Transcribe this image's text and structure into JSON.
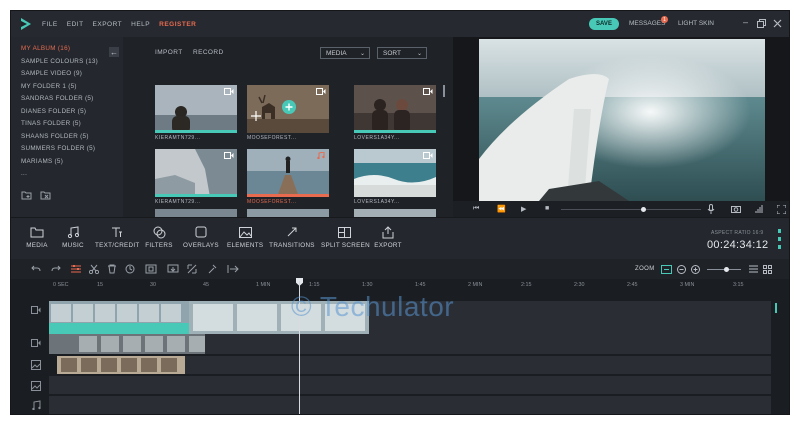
{
  "menu": {
    "items": [
      "FILE",
      "EDIT",
      "EXPORT",
      "HELP",
      "REGISTER"
    ]
  },
  "header": {
    "save_label": "SAVE",
    "messages_label": "MESSAGES",
    "messages_badge": "1",
    "skin_label": "LIGHT SKIN"
  },
  "folders": [
    "MY ALBUM (16)",
    "SAMPLE COLOURS (13)",
    "SAMPLE VIDEO (9)",
    "MY FOLDER 1 (5)",
    "SANDRAS FOLDER (5)",
    "DIANES FOLDER (5)",
    "TINAS FOLDER (5)",
    "SHAANS FOLDER (5)",
    "SUMMERS FOLDER (5)",
    "MARIAMS (5)",
    "..."
  ],
  "library": {
    "import_label": "IMPORT",
    "record_label": "RECORD",
    "media_select": "MEDIA",
    "sort_select": "SORT",
    "thumbs": [
      {
        "label": "KIERAMTN729...",
        "type": "video"
      },
      {
        "label": "MOOSEFOREST...",
        "type": "video"
      },
      {
        "label": "LOVERS1A34Y...",
        "type": "video"
      },
      {
        "label": "KIERAMTN729...",
        "type": "video"
      },
      {
        "label": "MOOSEFOREST...",
        "type": "audio"
      },
      {
        "label": "LOVERS1A34Y...",
        "type": "video"
      }
    ]
  },
  "tools": [
    {
      "label": "MEDIA",
      "icon": "folder-icon"
    },
    {
      "label": "MUSIC",
      "icon": "music-icon"
    },
    {
      "label": "TEXT/CREDIT",
      "icon": "text-icon"
    },
    {
      "label": "FILTERS",
      "icon": "filters-icon"
    },
    {
      "label": "OVERLAYS",
      "icon": "overlays-icon"
    },
    {
      "label": "ELEMENTS",
      "icon": "elements-icon"
    },
    {
      "label": "TRANSITIONS",
      "icon": "transitions-icon"
    },
    {
      "label": "SPLIT SCREEN",
      "icon": "split-screen-icon"
    },
    {
      "label": "EXPORT",
      "icon": "export-icon"
    }
  ],
  "project": {
    "aspect_ratio": "ASPECT RATIO 16:9",
    "timecode": "00:24:34:12"
  },
  "timeline": {
    "zoom_label": "ZOOM",
    "ruler": [
      "0 SEC",
      "15",
      "30",
      "45",
      "1 MIN",
      "1:15",
      "1:30",
      "1:45",
      "2 MIN",
      "2:15",
      "2:30",
      "2:45",
      "3 MIN",
      "3:15"
    ]
  },
  "watermark": "© Techulator",
  "colors": {
    "accent": "#48c9b8",
    "highlight": "#e86a4f",
    "background": "#1f2227"
  }
}
